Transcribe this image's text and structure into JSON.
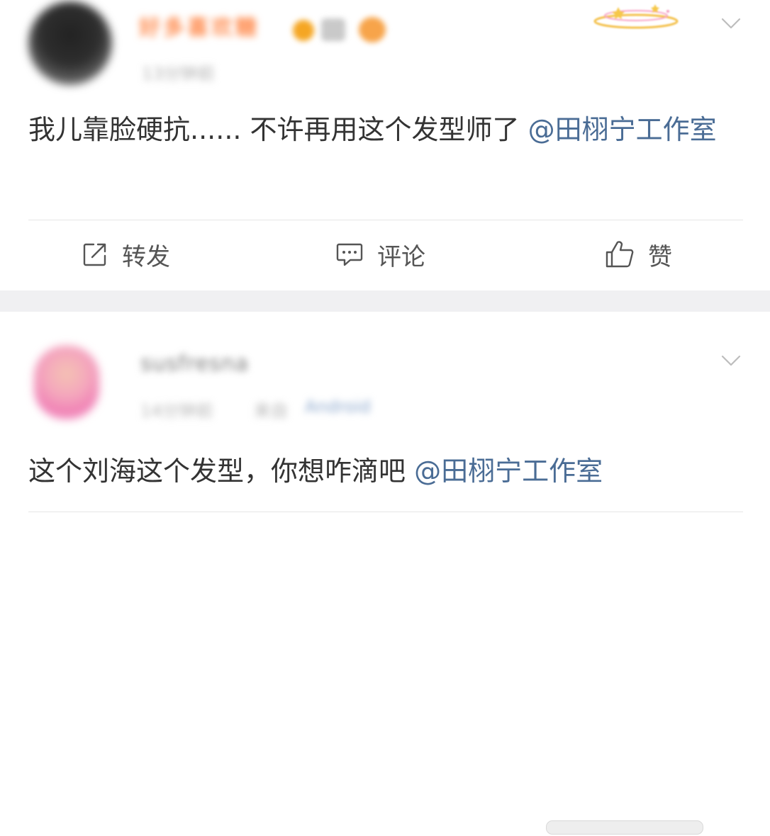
{
  "post1": {
    "author_name": "好多喜欢糖",
    "timestamp": "13分钟前",
    "text": "我儿靠脸硬抗...... 不许再用这个发型师了",
    "mention": "@田栩宁工作室",
    "actions": {
      "repost": "转发",
      "comment": "评论",
      "like": "赞"
    }
  },
  "post2": {
    "author_name": "susfresna",
    "timestamp": "14分钟前",
    "via_label": "来自",
    "source": "Android",
    "text": "这个刘海这个发型，你想咋滴吧",
    "mention": "@田栩宁工作室"
  },
  "icons": {
    "menu": "chevron-down-icon",
    "repost": "share-square-icon",
    "comment": "comment-bubble-icon",
    "like": "thumbs-up-icon"
  },
  "colors": {
    "mention": "#4a6c95",
    "separator": "#f0f0f2",
    "action_text": "#555555"
  }
}
